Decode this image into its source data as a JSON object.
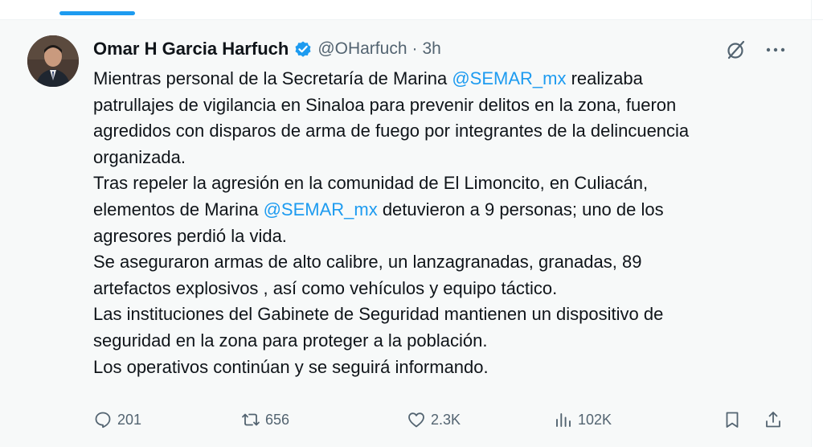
{
  "tweet": {
    "author_name": "Omar H Garcia Harfuch",
    "handle": "@OHarfuch",
    "separator": "·",
    "time": "3h",
    "verified": true,
    "body": {
      "line1_a": "Mientras personal de la Secretaría de Marina ",
      "line1_mention": "@SEMAR_mx",
      "line1_b": " realizaba",
      "line2": "patrullajes de vigilancia en Sinaloa para prevenir delitos en la zona, fueron",
      "line3": "agredidos con disparos de arma de fuego por integrantes de la delincuencia",
      "line4": "organizada.",
      "line5": "Tras repeler la agresión en la comunidad de El Limoncito, en Culiacán,",
      "line6_a": "elementos de Marina ",
      "line6_mention": "@SEMAR_mx",
      "line6_b": " detuvieron a 9 personas; uno de los",
      "line7": "agresores perdió la vida.",
      "line8": "Se aseguraron armas de alto calibre, un lanzagranadas, granadas, 89",
      "line9": "artefactos explosivos , así como vehículos y equipo táctico.",
      "line10": "Las instituciones del Gabinete de Seguridad mantienen un dispositivo de",
      "line11": "seguridad en la zona para proteger a la población.",
      "line12": "Los operativos continúan y se seguirá informando."
    },
    "stats": {
      "replies": "201",
      "retweets": "656",
      "likes": "2.3K",
      "views": "102K"
    }
  },
  "icons": {
    "verified": "verified-badge-icon",
    "grok": "grok-icon",
    "more": "more-icon",
    "reply": "reply-icon",
    "retweet": "retweet-icon",
    "like": "like-icon",
    "views": "views-icon",
    "bookmark": "bookmark-icon",
    "share": "share-icon"
  },
  "colors": {
    "accent": "#1d9bf0",
    "text": "#0f1419",
    "secondary": "#536471",
    "background": "#f7f9f9"
  }
}
